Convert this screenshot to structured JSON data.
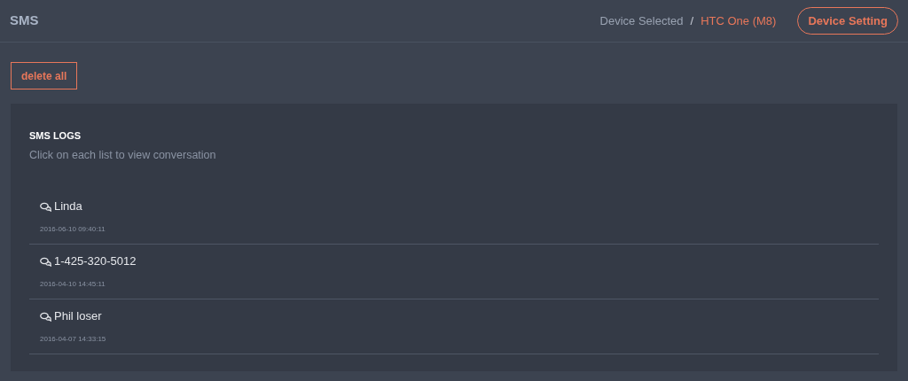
{
  "header": {
    "title": "SMS",
    "breadcrumb": {
      "label": "Device Selected",
      "separator": "/",
      "device": "HTC One (M8)"
    },
    "button": "Device Setting"
  },
  "delete_button": "delete all",
  "logs": {
    "title": "SMS LOGS",
    "subtitle": "Click on each list to view conversation",
    "items": [
      {
        "name": "Linda",
        "time": "2016-06-10 09:40:11"
      },
      {
        "name": "1-425-320-5012",
        "time": "2016-04-10 14:45:11"
      },
      {
        "name": "Phil loser",
        "time": "2016-04-07 14:33:15"
      }
    ]
  }
}
